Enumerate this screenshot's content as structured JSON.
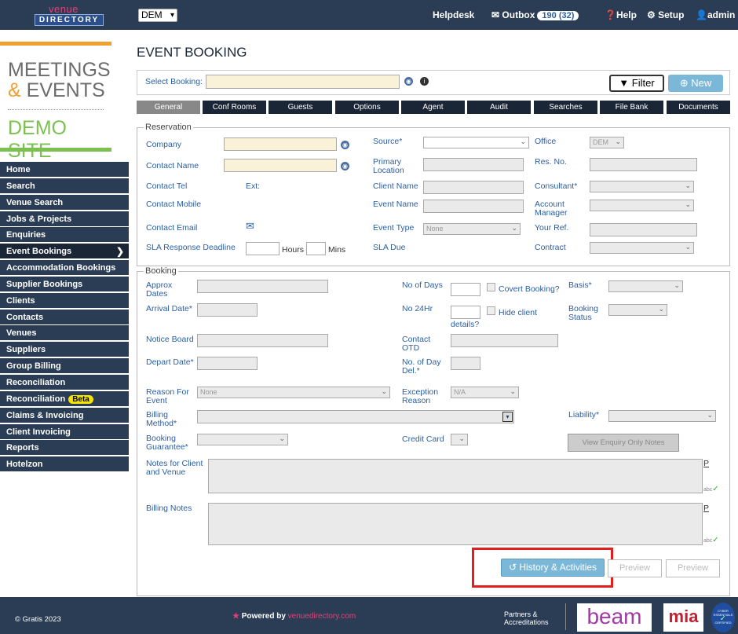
{
  "header": {
    "logo_top": "venue",
    "logo_bottom": "DIRECTORY",
    "site_select": "DEM",
    "helpdesk": "Helpdesk",
    "outbox": "Outbox",
    "outbox_count": "190 (32)",
    "help": "Help",
    "setup": "Setup",
    "user": "admin"
  },
  "brand": {
    "line1": "MEETINGS",
    "amp": "&",
    "line2": "EVENTS",
    "line3": "DEMO SITE"
  },
  "sidebar": {
    "items": [
      "Home",
      "Search",
      "Venue Search",
      "Jobs & Projects",
      "Enquiries",
      "Event Bookings",
      "Accommodation Bookings",
      "Supplier Bookings",
      "Clients",
      "Contacts",
      "Venues",
      "Suppliers",
      "Group Billing",
      "Reconciliation",
      "Reconciliation",
      "Claims & Invoicing",
      "Client Invoicing",
      "Reports",
      "Hotelzon"
    ],
    "beta": "Beta",
    "active": "Event Bookings"
  },
  "page": {
    "title": "EVENT BOOKING",
    "select_booking": "Select Booking:",
    "filter": "Filter",
    "new": "New"
  },
  "tabs": [
    "General",
    "Conf Rooms",
    "Guests",
    "Options",
    "Agent",
    "Audit",
    "Searches",
    "File Bank",
    "Documents"
  ],
  "reservation": {
    "legend": "Reservation",
    "company": "Company",
    "contact_name": "Contact Name",
    "contact_tel": "Contact Tel",
    "ext": "Ext:",
    "contact_mobile": "Contact Mobile",
    "contact_email": "Contact Email",
    "sla_deadline": "SLA Response Deadline",
    "hours": "Hours",
    "mins": "Mins",
    "source": "Source*",
    "primary_location": "Primary Location",
    "client_name": "Client Name",
    "event_name": "Event Name",
    "event_type": "Event Type",
    "event_type_value": "None",
    "sla_due": "SLA Due",
    "office": "Office",
    "office_value": "DEM",
    "res_no": "Res. No.",
    "consultant": "Consultant*",
    "account_manager": "Account Manager",
    "your_ref": "Your Ref.",
    "contract": "Contract"
  },
  "booking": {
    "legend": "Booking",
    "approx_dates": "Approx Dates",
    "arrival_date": "Arrival Date*",
    "notice_board": "Notice Board",
    "depart_date": "Depart Date*",
    "reason_for_event": "Reason For Event",
    "reason_value": "None",
    "billing_method": "Billing Method*",
    "booking_guarantee": "Booking Guarantee*",
    "no_of_days": "No of Days",
    "covert_booking": "Covert Booking?",
    "no_24hr": "No 24Hr",
    "hide_client": "Hide client",
    "details": "details?",
    "contact_otd": "Contact OTD",
    "no_day_del": "No. of Day Del.*",
    "exception_reason": "Exception Reason",
    "exception_value": "N/A",
    "credit_card": "Credit Card",
    "basis": "Basis*",
    "booking_status": "Booking Status",
    "liability": "Liability*",
    "view_enquiry_notes": "View Enquiry Only Notes",
    "notes_client_venue": "Notes for Client and Venue",
    "billing_notes": "Billing Notes",
    "p": "P",
    "abc": "abc",
    "history": "History & Activities",
    "preview1": "Preview",
    "preview2": "Preview"
  },
  "footer": {
    "copyright": "© Gratis 2023",
    "powered_by": "Powered by",
    "powered_site": "venuedirectory.com",
    "partners": "Partners &",
    "accreditations": "Accreditations",
    "beam": "beam",
    "mia": "mia",
    "cyber": "CYBER ESSENTIALS",
    "certified": "CERTIFIED"
  },
  "colors": {
    "header_bg": "#2b3d55",
    "accent_blue": "#7bb8d8",
    "highlight_red": "#e02020",
    "orange": "#f0a030",
    "green": "#7cc050"
  }
}
